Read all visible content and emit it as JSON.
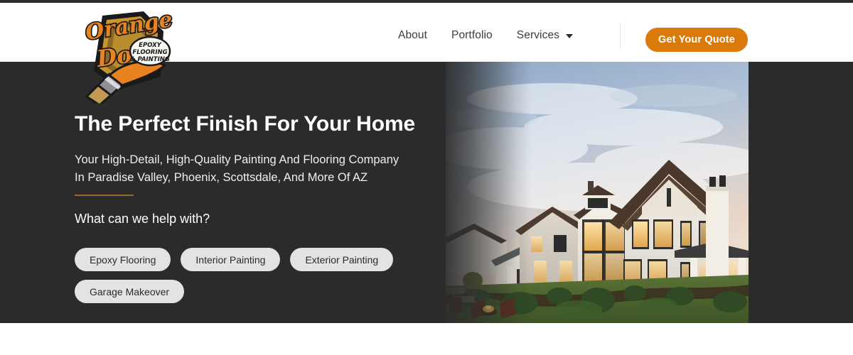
{
  "site": {
    "brand_name": "Orange Door",
    "logo_badge_lines": [
      "EPOXY",
      "FLOORING",
      "& PAINTING"
    ],
    "accent_color": "#da7a0a",
    "dark_bg_color": "#2b2b2b",
    "rule_color": "#9b6a2d",
    "chip_bg_color": "#e3e3e1"
  },
  "header": {
    "logo_icon": "orange-door-logo-icon",
    "nav": [
      {
        "label": "About",
        "has_dropdown": false
      },
      {
        "label": "Portfolio",
        "has_dropdown": false
      },
      {
        "label": "Services",
        "has_dropdown": true,
        "caret_icon": "chevron-down-icon"
      }
    ],
    "cta": {
      "label": "Get Your Quote"
    }
  },
  "hero": {
    "title": "The Perfect Finish For Your Home",
    "subtitle_line1": "Your High-Detail, High-Quality Painting And Flooring Company",
    "subtitle_line2": "In Paradise Valley, Phoenix, Scottsdale, And More Of AZ",
    "prompt": "What can we help with?",
    "chips": [
      {
        "label": "Epoxy Flooring"
      },
      {
        "label": "Interior Painting"
      },
      {
        "label": "Exterior Painting"
      },
      {
        "label": "Garage Makeover"
      }
    ],
    "photo": {
      "alt": "Large white two-story luxury home at dusk with dark shingled roof, chimney, warm-lit windows and green lawn",
      "icon": "house-photo"
    }
  }
}
